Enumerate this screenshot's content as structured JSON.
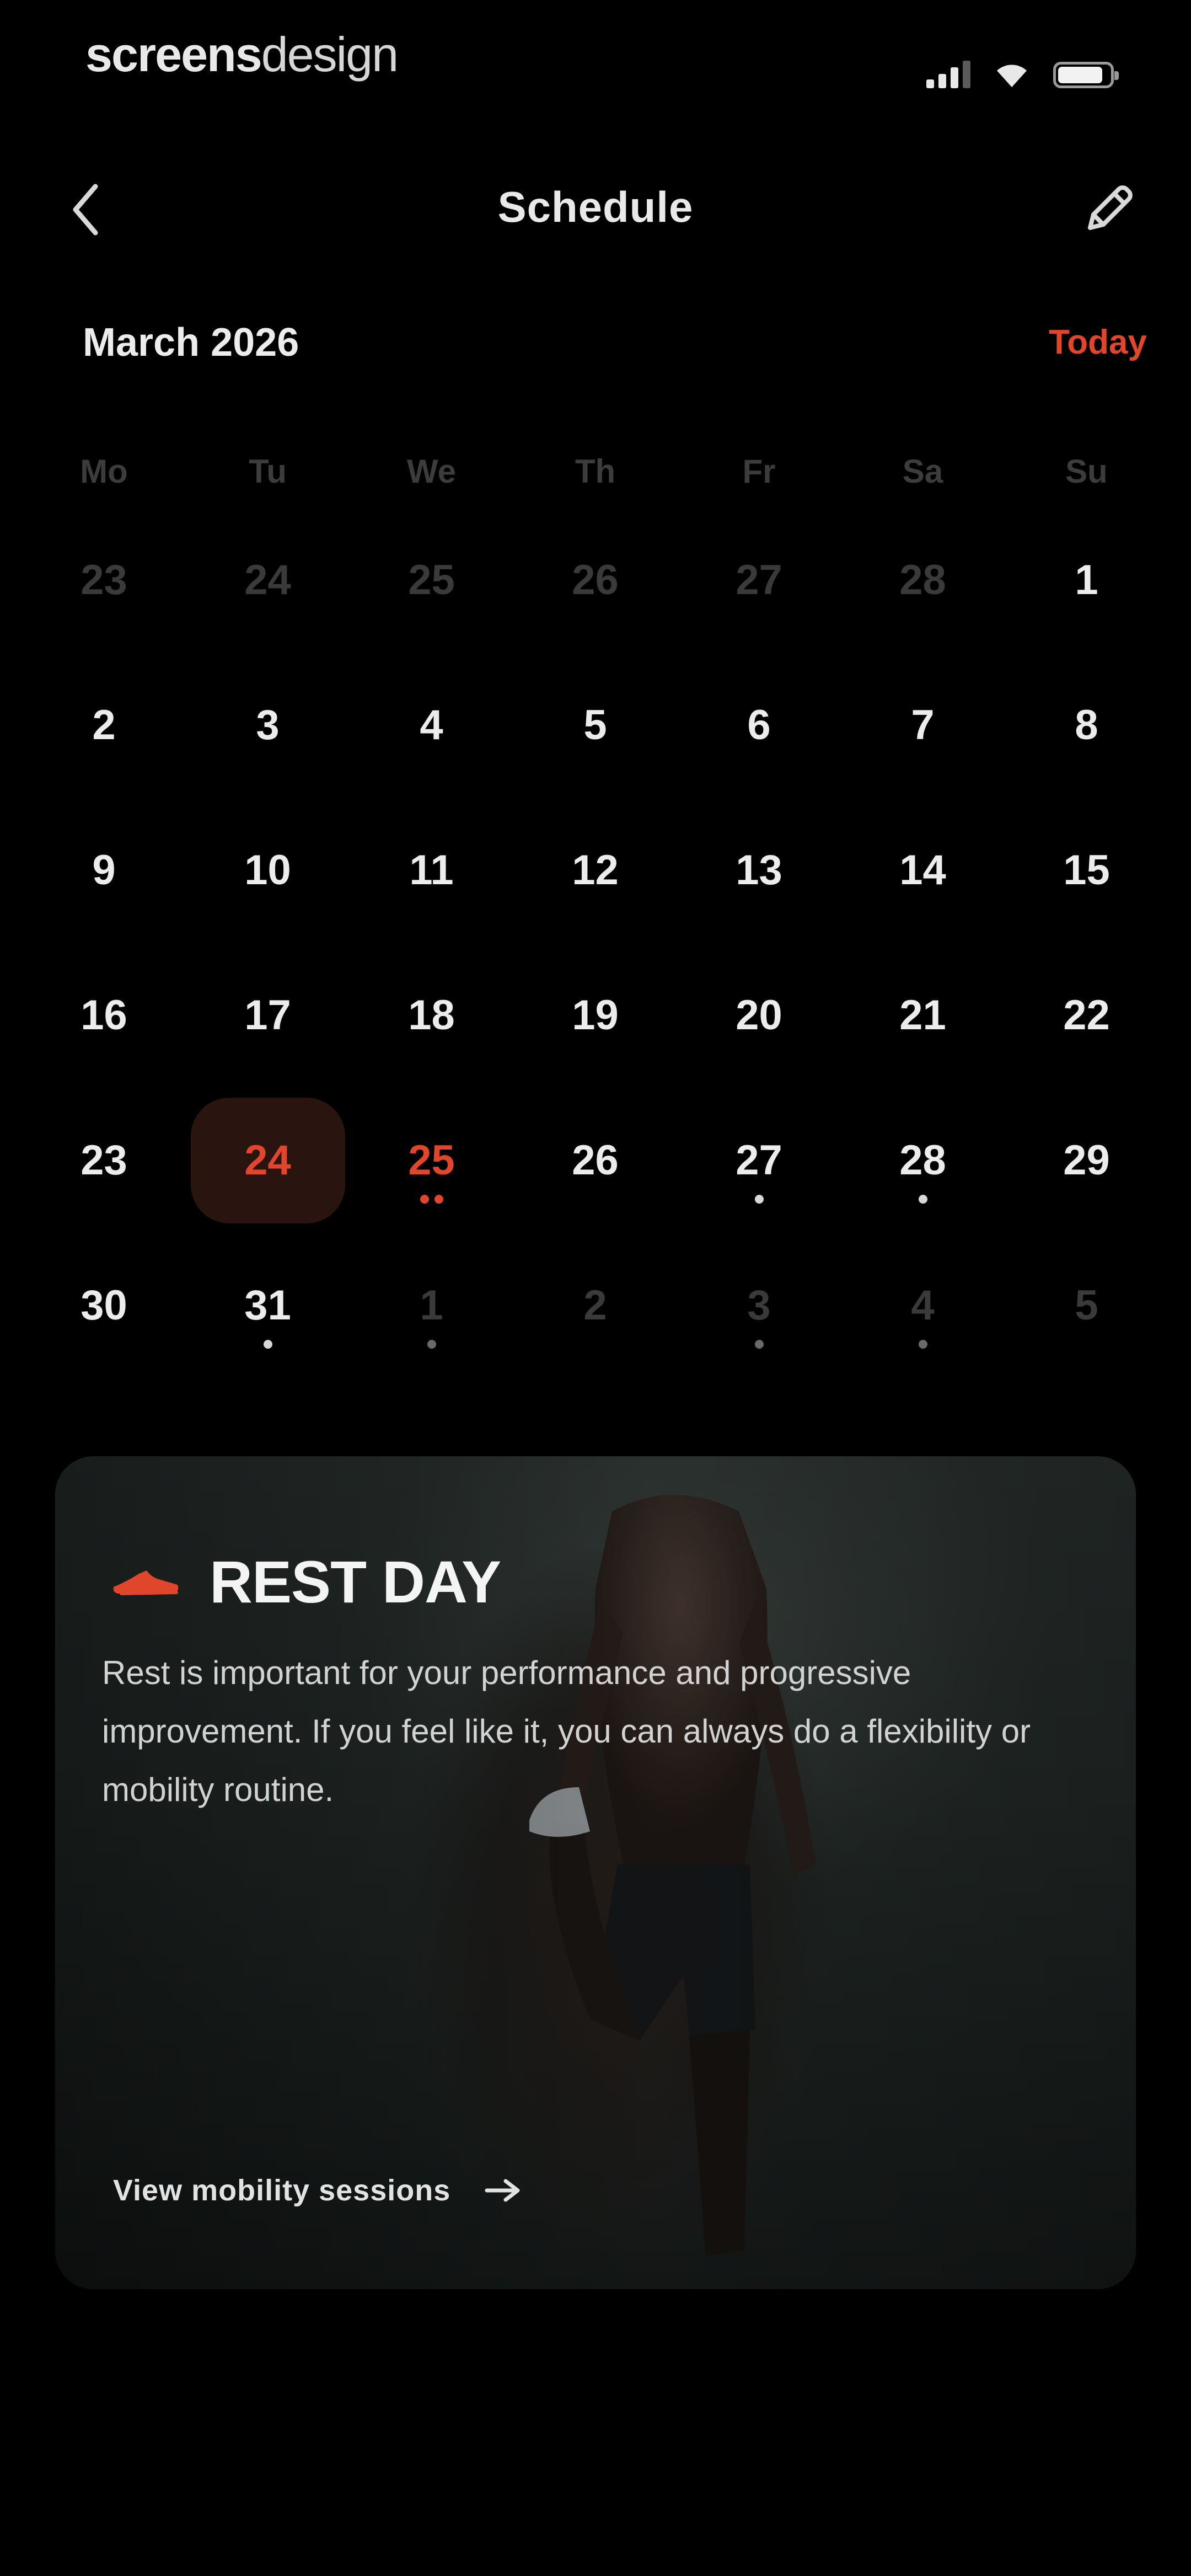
{
  "status_bar": {
    "brand_bold": "screens",
    "brand_light": "design",
    "icons": [
      "signal-icon",
      "wifi-icon",
      "battery-icon"
    ]
  },
  "nav": {
    "title": "Schedule",
    "back_icon": "chevron-left-icon",
    "edit_icon": "pencil-icon"
  },
  "calendar": {
    "month_label": "March 2026",
    "today_label": "Today",
    "weekdays": [
      "Mo",
      "Tu",
      "We",
      "Th",
      "Fr",
      "Sa",
      "Su"
    ],
    "weeks": [
      [
        {
          "d": "23",
          "muted": true
        },
        {
          "d": "24",
          "muted": true
        },
        {
          "d": "25",
          "muted": true
        },
        {
          "d": "26",
          "muted": true
        },
        {
          "d": "27",
          "muted": true
        },
        {
          "d": "28",
          "muted": true
        },
        {
          "d": "1"
        }
      ],
      [
        {
          "d": "2"
        },
        {
          "d": "3"
        },
        {
          "d": "4"
        },
        {
          "d": "5"
        },
        {
          "d": "6"
        },
        {
          "d": "7"
        },
        {
          "d": "8"
        }
      ],
      [
        {
          "d": "9"
        },
        {
          "d": "10"
        },
        {
          "d": "11"
        },
        {
          "d": "12"
        },
        {
          "d": "13"
        },
        {
          "d": "14"
        },
        {
          "d": "15"
        }
      ],
      [
        {
          "d": "16"
        },
        {
          "d": "17"
        },
        {
          "d": "18"
        },
        {
          "d": "19"
        },
        {
          "d": "20"
        },
        {
          "d": "21"
        },
        {
          "d": "22"
        }
      ],
      [
        {
          "d": "23"
        },
        {
          "d": "24",
          "selected": true
        },
        {
          "d": "25",
          "today": true,
          "dots": 2,
          "dot_color": "accent"
        },
        {
          "d": "26"
        },
        {
          "d": "27",
          "dots": 1
        },
        {
          "d": "28",
          "dots": 1
        },
        {
          "d": "29"
        }
      ],
      [
        {
          "d": "30"
        },
        {
          "d": "31",
          "dots": 1
        },
        {
          "d": "1",
          "muted": true,
          "dots": 1
        },
        {
          "d": "2",
          "muted": true
        },
        {
          "d": "3",
          "muted": true,
          "dots": 1
        },
        {
          "d": "4",
          "muted": true,
          "dots": 1
        },
        {
          "d": "5",
          "muted": true
        }
      ]
    ]
  },
  "rest_card": {
    "icon": "sneaker-icon",
    "title": "REST DAY",
    "description": "Rest is important for your performance and progressive improvement. If you feel like it, you can always do a flexibility or mobility routine.",
    "link_label": "View mobility sessions",
    "link_icon": "arrow-right-icon"
  },
  "colors": {
    "background": "#000000",
    "accent": "#e0462c",
    "selected_bg": "#2a140f",
    "muted_text": "#3a3a3a"
  }
}
